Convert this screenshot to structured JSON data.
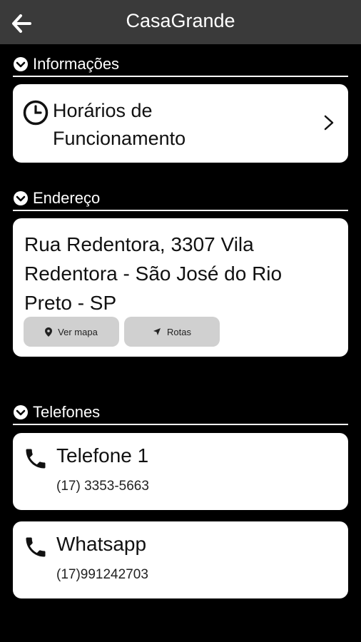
{
  "appbar": {
    "title": "CasaGrande",
    "back_icon": "arrow-left-icon"
  },
  "sections": {
    "info": {
      "label": "Informações"
    },
    "address": {
      "label": "Endereço"
    },
    "phones": {
      "label": "Telefones"
    }
  },
  "hours": {
    "line1": "Horários de",
    "line2": "Funcionamento"
  },
  "address": {
    "line1": "Rua Redentora, 3307 Vila",
    "line2": "Redentora - São José do Rio",
    "line3": "Preto - SP",
    "map_button": "Ver mapa",
    "route_button": "Rotas"
  },
  "phones": [
    {
      "title": "Telefone 1",
      "number": "(17) 3353-5663"
    },
    {
      "title": "Whatsapp",
      "number": "(17)991242703"
    }
  ],
  "colors": {
    "appbar": "#3a3a3a",
    "background": "#000000",
    "card": "#ffffff",
    "pill": "#d0d0d0"
  }
}
